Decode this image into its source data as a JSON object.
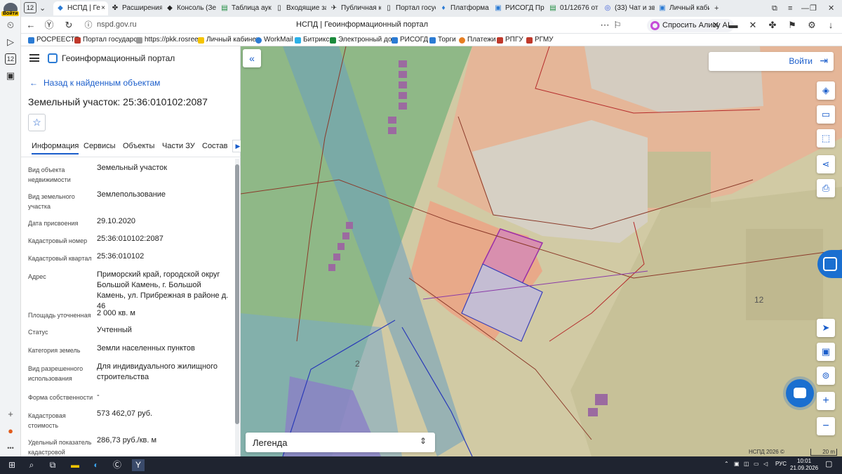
{
  "browser": {
    "profile_badge": "Войти",
    "tab_count": "12",
    "tabs": [
      {
        "label": "НСПД | Ге",
        "active": true
      },
      {
        "label": "Расширения"
      },
      {
        "label": "Консоль (Зе"
      },
      {
        "label": "Таблица аукц"
      },
      {
        "label": "Входящие за"
      },
      {
        "label": "Публичная к"
      },
      {
        "label": "Портал госус"
      },
      {
        "label": "Платформа с"
      },
      {
        "label": "РИСОГД Пр"
      },
      {
        "label": "01/12676 от"
      },
      {
        "label": "(33) Чат и зв"
      },
      {
        "label": "Личный каби"
      }
    ],
    "url": "nspd.gov.ru",
    "page_title": "НСПД | Геоинформационный портал",
    "alice_button": "Спросить Алису AI",
    "bookmarks": [
      "РОСРЕЕСТР",
      "Портал государс",
      "https://pkk.rosree",
      "Личный кабинет",
      "WorkMail",
      "Битрикс",
      "Электронный до",
      "РИСОГД",
      "Торги",
      "Платежи",
      "РПГУ",
      "РГМУ"
    ]
  },
  "panel": {
    "app_title": "Геоинформационный портал",
    "back_link": "Назад к найденным объектам",
    "object_title": "Земельный участок: 25:36:010102:2087",
    "tabs": [
      "Информация",
      "Сервисы",
      "Объекты",
      "Части ЗУ",
      "Состав"
    ],
    "properties": [
      {
        "key": "Вид объекта недвижимости",
        "value": "Земельный участок"
      },
      {
        "key": "Вид земельного участка",
        "value": "Землепользование"
      },
      {
        "key": "Дата присвоения",
        "value": "29.10.2020"
      },
      {
        "key": "Кадастровый номер",
        "value": "25:36:010102:2087"
      },
      {
        "key": "Кадастровый квартал",
        "value": "25:36:010102"
      },
      {
        "key": "Адрес",
        "value": "Приморский край, городской округ Большой Камень, г. Большой Камень, ул. Прибрежная в районе д. 46"
      },
      {
        "key": "Площадь уточненная",
        "value": "2 000 кв. м"
      },
      {
        "key": "Статус",
        "value": "Учтенный"
      },
      {
        "key": "Категория земель",
        "value": "Земли населенных пунктов"
      },
      {
        "key": "Вид разрешенного использования",
        "value": "Для индивидуального жилищного строительства"
      },
      {
        "key": "Форма собственности",
        "value": "-"
      },
      {
        "key": "Кадастровая стоимость",
        "value": "573 462,07 руб."
      },
      {
        "key": "Удельный показатель кадастровой",
        "value": "286,73 руб./кв. м"
      }
    ]
  },
  "map": {
    "login_label": "Войти",
    "legend_label": "Легенда",
    "attribution": "НСПД 2026 ©",
    "scale_label": "20 m",
    "labels": [
      "12",
      "2"
    ]
  },
  "taskbar": {
    "lang": "РУС",
    "time": "10:01",
    "date": "21.09.2026"
  }
}
